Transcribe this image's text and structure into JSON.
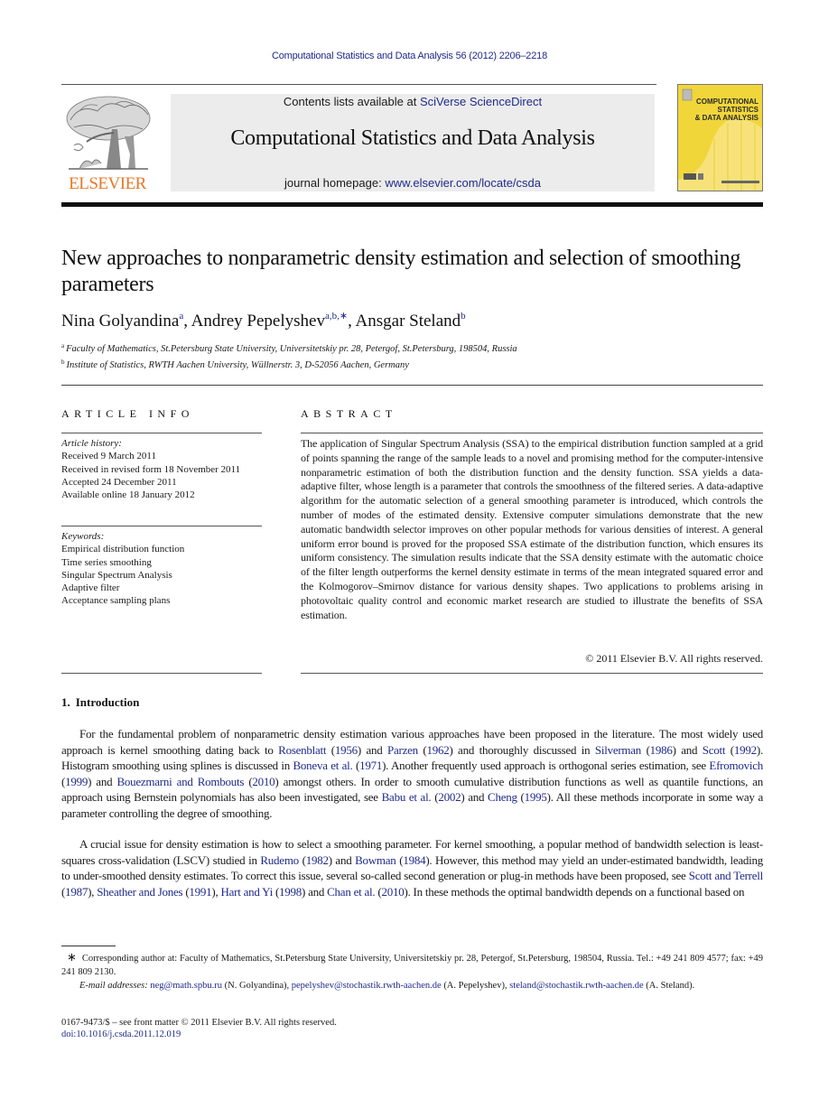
{
  "running_head": "Computational Statistics and Data Analysis 56 (2012) 2206–2218",
  "publisher": {
    "name": "ELSEVIER",
    "logo_icon": "elsevier-tree-icon"
  },
  "journal_box": {
    "contents_prefix": "Contents lists available at ",
    "contents_link": "SciVerse ScienceDirect",
    "journal_title": "Computational Statistics and Data Analysis",
    "homepage_prefix": "journal homepage: ",
    "homepage_link": "www.elsevier.com/locate/csda"
  },
  "journal_cover": {
    "title_lines": [
      "COMPUTATIONAL",
      "STATISTICS",
      "& DATA ANALYSIS"
    ]
  },
  "article": {
    "title": "New approaches to nonparametric density estimation and selection of smoothing parameters",
    "authors": [
      {
        "name": "Nina Golyandina",
        "sup": "a"
      },
      {
        "name": "Andrey Pepelyshev",
        "sup": "a,b,∗"
      },
      {
        "name": "Ansgar Steland",
        "sup": "b"
      }
    ],
    "affiliations": [
      {
        "mark": "a",
        "text": "Faculty of Mathematics, St.Petersburg State University, Universitetskiy pr. 28, Petergof, St.Petersburg, 198504, Russia"
      },
      {
        "mark": "b",
        "text": "Institute of Statistics, RWTH Aachen University, Wüllnerstr. 3, D-52056 Aachen, Germany"
      }
    ]
  },
  "article_info": {
    "heading": "ARTICLE INFO",
    "history_label": "Article history:",
    "history": [
      "Received 9 March 2011",
      "Received in revised form 18 November 2011",
      "Accepted 24 December 2011",
      "Available online 18 January 2012"
    ],
    "keywords_label": "Keywords:",
    "keywords": [
      "Empirical distribution function",
      "Time series smoothing",
      "Singular Spectrum Analysis",
      "Adaptive filter",
      "Acceptance sampling plans"
    ]
  },
  "abstract": {
    "heading": "ABSTRACT",
    "text": "The application of Singular Spectrum Analysis (SSA) to the empirical distribution function sampled at a grid of points spanning the range of the sample leads to a novel and promising method for the computer-intensive nonparametric estimation of both the distribution function and the density function. SSA yields a data-adaptive filter, whose length is a parameter that controls the smoothness of the filtered series. A data-adaptive algorithm for the automatic selection of a general smoothing parameter is introduced, which controls the number of modes of the estimated density. Extensive computer simulations demonstrate that the new automatic bandwidth selector improves on other popular methods for various densities of interest. A general uniform error bound is proved for the proposed SSA estimate of the distribution function, which ensures its uniform consistency. The simulation results indicate that the SSA density estimate with the automatic choice of the filter length outperforms the kernel density estimate in terms of the mean integrated squared error and the Kolmogorov–Smirnov distance for various density shapes. Two applications to problems arising in photovoltaic quality control and economic market research are studied to illustrate the benefits of SSA estimation.",
    "copyright": "© 2011 Elsevier B.V. All rights reserved."
  },
  "introduction": {
    "number": "1.",
    "heading": "Introduction",
    "paragraphs": [
      [
        {
          "t": "For the fundamental problem of nonparametric density estimation various approaches have been proposed in the literature. The most widely used approach is kernel smoothing dating back to "
        },
        {
          "l": "Rosenblatt"
        },
        {
          "t": " ("
        },
        {
          "l": "1956"
        },
        {
          "t": ") and "
        },
        {
          "l": "Parzen"
        },
        {
          "t": " ("
        },
        {
          "l": "1962"
        },
        {
          "t": ") and thoroughly discussed in "
        },
        {
          "l": "Silverman"
        },
        {
          "t": " ("
        },
        {
          "l": "1986"
        },
        {
          "t": ") and "
        },
        {
          "l": "Scott"
        },
        {
          "t": " ("
        },
        {
          "l": "1992"
        },
        {
          "t": "). Histogram smoothing using splines is discussed in "
        },
        {
          "l": "Boneva et al."
        },
        {
          "t": " ("
        },
        {
          "l": "1971"
        },
        {
          "t": "). Another frequently used approach is orthogonal series estimation, see "
        },
        {
          "l": "Efromovich"
        },
        {
          "t": " ("
        },
        {
          "l": "1999"
        },
        {
          "t": ") and "
        },
        {
          "l": "Bouezmarni and Rombouts"
        },
        {
          "t": " ("
        },
        {
          "l": "2010"
        },
        {
          "t": ") amongst others. In order to smooth cumulative distribution functions as well as quantile functions, an approach using Bernstein polynomials has also been investigated, see "
        },
        {
          "l": "Babu et al."
        },
        {
          "t": " ("
        },
        {
          "l": "2002"
        },
        {
          "t": ") and "
        },
        {
          "l": "Cheng"
        },
        {
          "t": " ("
        },
        {
          "l": "1995"
        },
        {
          "t": "). All these methods incorporate in some way a parameter controlling the degree of smoothing."
        }
      ],
      [
        {
          "t": "A crucial issue for density estimation is how to select a smoothing parameter. For kernel smoothing, a popular method of bandwidth selection is least-squares cross-validation (LSCV) studied in "
        },
        {
          "l": "Rudemo"
        },
        {
          "t": " ("
        },
        {
          "l": "1982"
        },
        {
          "t": ") and "
        },
        {
          "l": "Bowman"
        },
        {
          "t": " ("
        },
        {
          "l": "1984"
        },
        {
          "t": "). However, this method may yield an under-estimated bandwidth, leading to under-smoothed density estimates. To correct this issue, several so-called second generation or plug-in methods have been proposed, see "
        },
        {
          "l": "Scott and Terrell"
        },
        {
          "t": " ("
        },
        {
          "l": "1987"
        },
        {
          "t": "), "
        },
        {
          "l": "Sheather and Jones"
        },
        {
          "t": " ("
        },
        {
          "l": "1991"
        },
        {
          "t": "), "
        },
        {
          "l": "Hart and Yi"
        },
        {
          "t": " ("
        },
        {
          "l": "1998"
        },
        {
          "t": ") and "
        },
        {
          "l": "Chan et al."
        },
        {
          "t": " ("
        },
        {
          "l": "2010"
        },
        {
          "t": "). In these methods the optimal bandwidth depends on a functional based on"
        }
      ]
    ]
  },
  "footnote": {
    "star": "∗",
    "corresponding": "Corresponding author at: Faculty of Mathematics, St.Petersburg State University, Universitetskiy pr. 28, Petergof, St.Petersburg, 198504, Russia. Tel.: +49 241 809 4577; fax: +49 241 809 2130.",
    "email_label": "E-mail addresses: ",
    "emails": [
      {
        "address": "neg@math.spbu.ru",
        "who": " (N. Golyandina), "
      },
      {
        "address": "pepelyshev@stochastik.rwth-aachen.de",
        "who": " (A. Pepelyshev), "
      },
      {
        "address": "steland@stochastik.rwth-aachen.de",
        "who": " (A. Steland)."
      }
    ]
  },
  "front_matter": "0167-9473/$ – see front matter © 2011 Elsevier B.V. All rights reserved.",
  "doi": "doi:10.1016/j.csda.2011.12.019",
  "colors": {
    "link": "#1f2a8a",
    "publisher_orange": "#e8782a",
    "journal_box_bg": "#ececec",
    "cover_yellow": "#f1d63a"
  }
}
